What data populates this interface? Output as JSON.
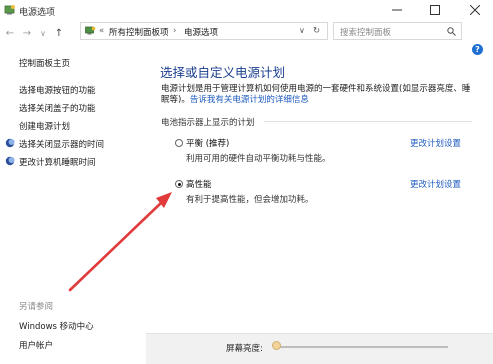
{
  "window": {
    "title": "电源选项"
  },
  "toolbar": {
    "back": "←",
    "forward": "→",
    "dropdown": "∨",
    "up": "↑",
    "refresh": "↻"
  },
  "address": {
    "chevron": "«",
    "crumb1": "所有控制面板项",
    "sep": "›",
    "crumb2": "电源选项",
    "dropdown": "∨"
  },
  "search": {
    "placeholder": "搜索控制面板"
  },
  "help": {
    "label": "?"
  },
  "sidebar": {
    "home": "控制面板主页",
    "items": [
      {
        "label": "选择电源按钮的功能"
      },
      {
        "label": "选择关闭盖子的功能"
      },
      {
        "label": "创建电源计划"
      },
      {
        "label": "选择关闭显示器的时间"
      },
      {
        "label": "更改计算机睡眠时间"
      }
    ],
    "see_also_title": "另请参阅",
    "see_also": [
      {
        "label": "Windows 移动中心"
      },
      {
        "label": "用户帐户"
      }
    ]
  },
  "main": {
    "title": "选择或自定义电源计划",
    "desc_text": "电源计划是用于管理计算机如何使用电源的一套硬件和系统设置(如显示器亮度、睡眠等)。",
    "desc_link": "告诉我有关电源计划的详细信息",
    "section": "电池指示器上显示的计划",
    "plans": [
      {
        "name": "平衡 (推荐)",
        "desc": "利用可用的硬件自动平衡功耗与性能。",
        "link": "更改计划设置",
        "selected": false
      },
      {
        "name": "高性能",
        "desc": "有利于提高性能，但会增加功耗。",
        "link": "更改计划设置",
        "selected": true
      }
    ]
  },
  "bottom": {
    "brightness_label": "屏幕亮度:"
  },
  "colors": {
    "accent": "#1e5bbf",
    "title": "#1b3f8f",
    "annotation_arrow": "#e03a3a"
  }
}
